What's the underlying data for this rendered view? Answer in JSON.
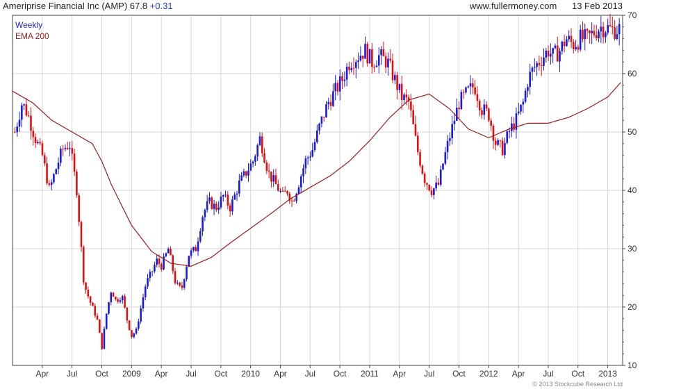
{
  "header": {
    "title": "Ameriprise Financial Inc (AMP) 67.8",
    "change": "+0.31",
    "source": "www.fullermoney.com",
    "date": "13 Feb 2013"
  },
  "legend": {
    "weekly": "Weekly",
    "ema": "EMA 200"
  },
  "footer": {
    "copyright": "© 2013 Stockcube Research Ltd"
  },
  "colors": {
    "up": "#1a1adb",
    "down": "#e01010",
    "ema": "#9b1c1c",
    "grid": "#d6d6d6",
    "axis": "#444444"
  },
  "chart_data": {
    "type": "candlestick",
    "title": "Ameriprise Financial Inc (AMP) 67.8 +0.31",
    "xlabel": "",
    "ylabel": "",
    "ylim": [
      10,
      70
    ],
    "y_ticks": [
      10,
      20,
      30,
      40,
      50,
      60,
      70
    ],
    "x_ticks": [
      "Apr",
      "Jul",
      "Oct",
      "2009",
      "Apr",
      "Jul",
      "Oct",
      "2010",
      "Apr",
      "Jul",
      "Oct",
      "2011",
      "Apr",
      "Jul",
      "Oct",
      "2012",
      "Apr",
      "Jul",
      "Oct",
      "2013"
    ],
    "x_tick_years": [
      2008.25,
      2008.5,
      2008.75,
      2009.0,
      2009.25,
      2009.5,
      2009.75,
      2010.0,
      2010.25,
      2010.5,
      2010.75,
      2011.0,
      2011.25,
      2011.5,
      2011.75,
      2012.0,
      2012.25,
      2012.5,
      2012.75,
      2013.0
    ],
    "x_range": [
      2008.0,
      2013.125
    ],
    "grid": true,
    "legend_position": "top-left",
    "series": [
      {
        "name": "Weekly",
        "kind": "close",
        "t": [
          2008.02,
          2008.08,
          2008.13,
          2008.19,
          2008.25,
          2008.31,
          2008.37,
          2008.42,
          2008.48,
          2008.54,
          2008.6,
          2008.65,
          2008.71,
          2008.75,
          2008.79,
          2008.83,
          2008.87,
          2008.92,
          2008.96,
          2009.0,
          2009.04,
          2009.08,
          2009.12,
          2009.17,
          2009.21,
          2009.25,
          2009.31,
          2009.37,
          2009.42,
          2009.48,
          2009.54,
          2009.6,
          2009.65,
          2009.71,
          2009.77,
          2009.83,
          2009.9,
          2009.96,
          2010.02,
          2010.08,
          2010.15,
          2010.21,
          2010.27,
          2010.31,
          2010.35,
          2010.4,
          2010.46,
          2010.52,
          2010.58,
          2010.65,
          2010.71,
          2010.77,
          2010.83,
          2010.9,
          2010.96,
          2011.02,
          2011.08,
          2011.15,
          2011.21,
          2011.27,
          2011.33,
          2011.4,
          2011.46,
          2011.52,
          2011.58,
          2011.62,
          2011.67,
          2011.71,
          2011.75,
          2011.79,
          2011.83,
          2011.88,
          2011.94,
          2012.0,
          2012.06,
          2012.12,
          2012.17,
          2012.23,
          2012.29,
          2012.33,
          2012.38,
          2012.42,
          2012.46,
          2012.5,
          2012.54,
          2012.6,
          2012.65,
          2012.71,
          2012.77,
          2012.83,
          2012.88,
          2012.94,
          2013.0,
          2013.04,
          2013.08,
          2013.11
        ],
        "values": [
          50,
          55,
          53,
          49,
          46,
          40,
          44,
          47,
          48,
          40,
          24,
          21,
          18,
          13,
          19,
          23,
          21,
          22,
          18,
          15,
          16,
          20,
          24,
          26,
          28,
          27,
          30,
          24,
          23,
          29,
          30,
          36,
          38,
          37,
          39,
          37,
          41,
          43,
          45,
          49,
          43,
          41,
          39,
          40,
          38,
          41,
          45,
          47,
          51,
          55,
          57,
          59,
          62,
          63,
          64,
          62,
          63,
          62,
          59,
          56,
          55,
          47,
          42,
          40,
          41,
          45,
          49,
          52,
          55,
          56,
          57,
          58,
          54,
          53,
          48,
          47,
          50,
          52,
          55,
          59,
          61,
          62,
          63,
          64,
          63,
          64,
          66,
          65,
          66,
          66,
          67,
          68,
          67.8,
          67.5,
          67.6,
          67.8
        ]
      },
      {
        "name": "EMA 200",
        "kind": "line",
        "t": [
          2008.0,
          2008.17,
          2008.33,
          2008.5,
          2008.67,
          2008.75,
          2008.83,
          2009.0,
          2009.17,
          2009.33,
          2009.5,
          2009.67,
          2009.83,
          2010.0,
          2010.17,
          2010.33,
          2010.5,
          2010.67,
          2010.83,
          2011.0,
          2011.17,
          2011.33,
          2011.5,
          2011.67,
          2011.83,
          2012.0,
          2012.17,
          2012.33,
          2012.5,
          2012.67,
          2012.83,
          2013.0,
          2013.11
        ],
        "values": [
          57,
          55,
          52,
          50,
          48,
          45,
          41,
          34,
          29.5,
          27.5,
          27,
          28.5,
          31,
          33.5,
          36,
          38.5,
          40.5,
          42.5,
          45,
          48.5,
          52.5,
          55.5,
          56.5,
          54,
          50.5,
          49,
          50.5,
          51.5,
          51.5,
          52.5,
          54,
          56,
          58.5
        ]
      }
    ]
  }
}
